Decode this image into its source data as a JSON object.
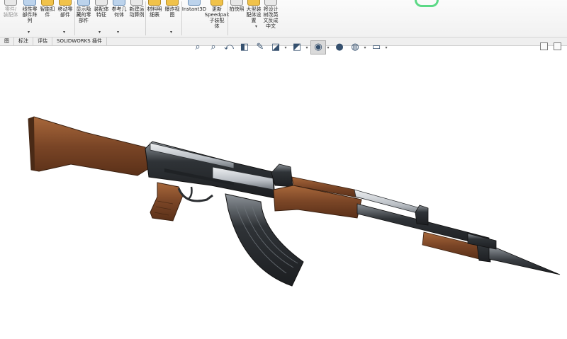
{
  "ribbon": {
    "buttons": [
      {
        "label": "零件/\n装配体",
        "faded": true
      },
      {
        "label": "线性零\n部件阵\n列"
      },
      {
        "label": "智能扣\n件"
      },
      {
        "label": "移动零\n部件"
      },
      {
        "label": "显示隐\n藏的零\n部件"
      },
      {
        "label": "装配体\n特征"
      },
      {
        "label": "参考几\n何体"
      },
      {
        "label": "新建运\n动算例"
      },
      {
        "label": "材料明\n细表"
      },
      {
        "label": "爆炸视\n图"
      },
      {
        "label": "Instant3D"
      },
      {
        "label": "更新\nSpeedpak\n子装配\n体"
      },
      {
        "label": "拍快照"
      },
      {
        "label": "大型装\n配体设\n置"
      },
      {
        "label": "将设计\n树改英\n文反成\n中文"
      }
    ],
    "caret": "▾"
  },
  "tabs": [
    {
      "label": "图"
    },
    {
      "label": "标注"
    },
    {
      "label": "评估"
    },
    {
      "label": "SOLIDWORKS 插件"
    }
  ],
  "view_toolbar": {
    "items": [
      {
        "name": "zoom-to-fit-icon",
        "glyph": "⌕",
        "dropdown": false
      },
      {
        "name": "zoom-to-area-icon",
        "glyph": "⌕",
        "dropdown": false
      },
      {
        "name": "previous-view-icon",
        "glyph": "⤺",
        "dropdown": false
      },
      {
        "name": "section-view-icon",
        "glyph": "◧",
        "dropdown": false
      },
      {
        "name": "dynamic-annotation-icon",
        "glyph": "✎",
        "dropdown": false
      },
      {
        "name": "view-orientation-icon",
        "glyph": "◪",
        "dropdown": true
      },
      {
        "name": "display-style-icon",
        "glyph": "◩",
        "dropdown": true
      },
      {
        "name": "hide-show-items-icon",
        "glyph": "◉",
        "dropdown": true,
        "active": true
      },
      {
        "name": "edit-appearance-icon",
        "glyph": "●",
        "dropdown": false
      },
      {
        "name": "apply-scene-icon",
        "glyph": "◍",
        "dropdown": true
      },
      {
        "name": "view-settings-icon",
        "glyph": "▭",
        "dropdown": true
      }
    ],
    "dropdown_glyph": "▾"
  },
  "colors": {
    "wood": "#7a4526",
    "wood_light": "#a8683b",
    "steel": "#3b3f44",
    "steel_light": "#c5c9ce"
  }
}
